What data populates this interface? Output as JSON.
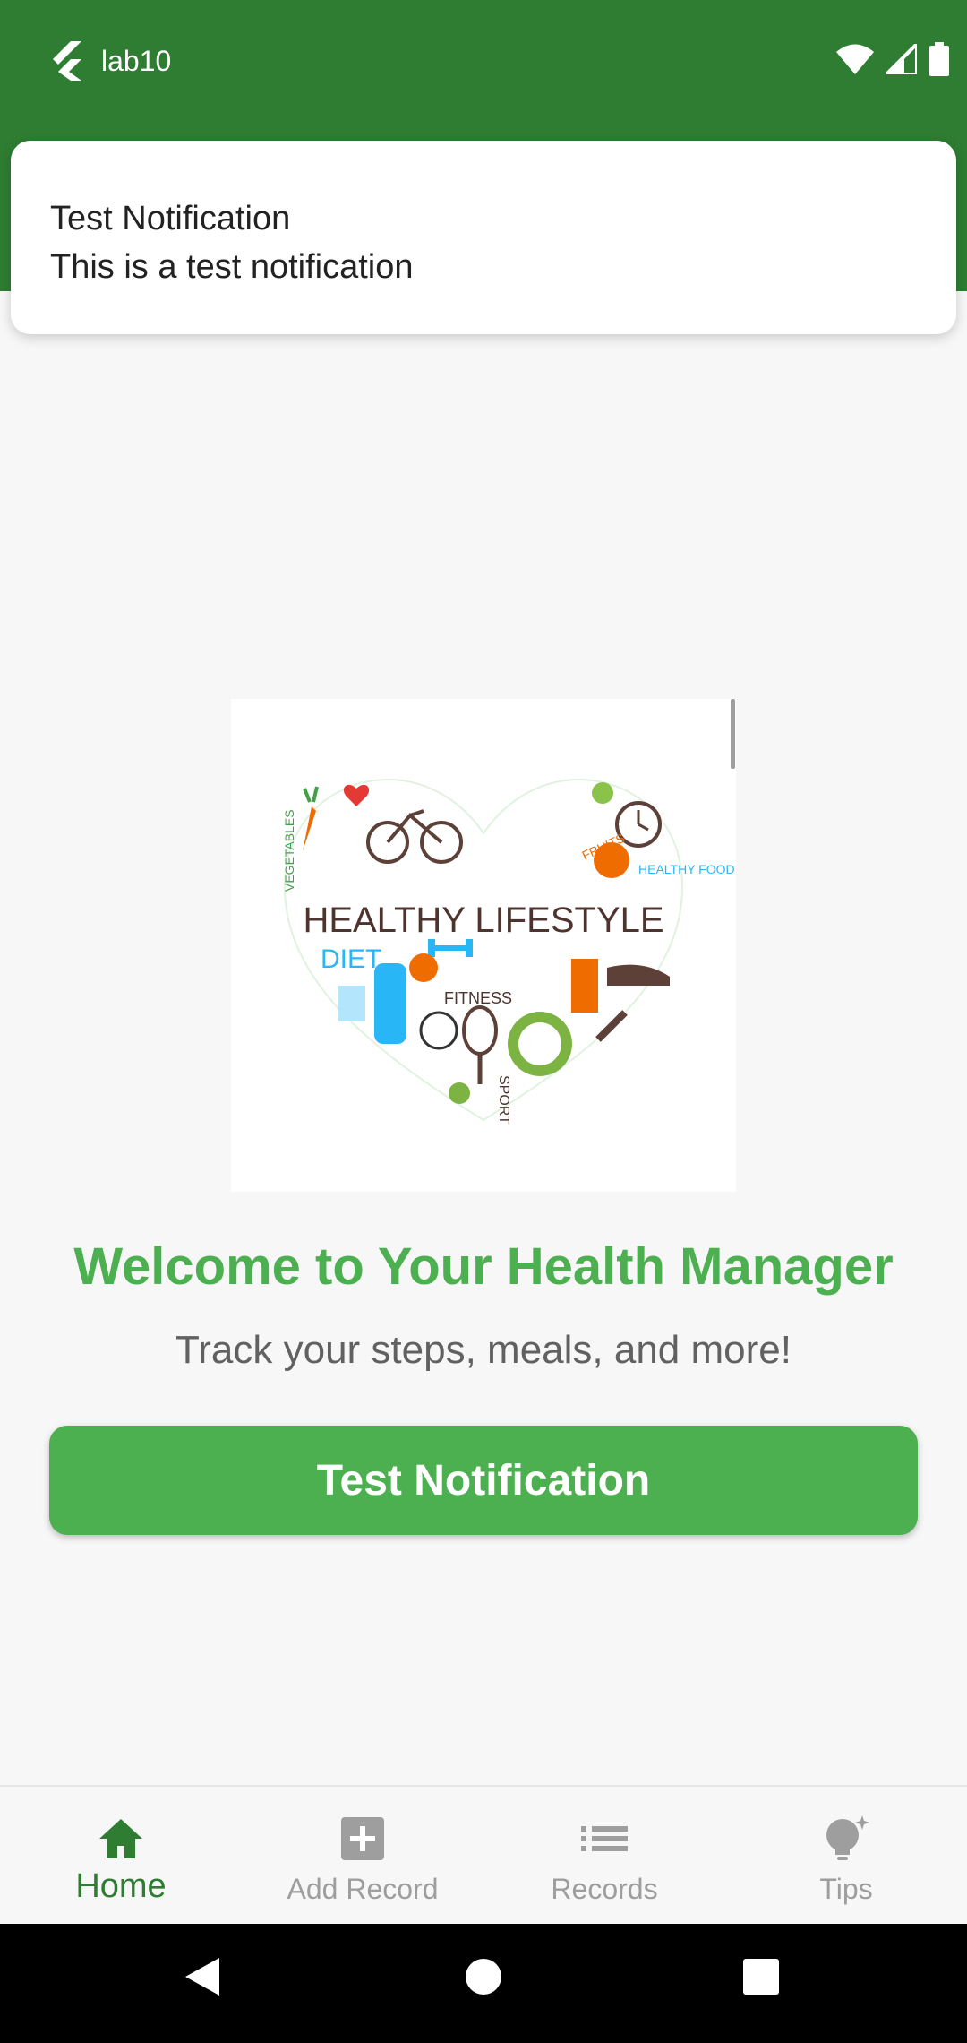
{
  "status_bar": {
    "app_name": "lab10",
    "icons": [
      "flutter-icon",
      "wifi-icon",
      "signal-icon",
      "battery-icon"
    ]
  },
  "notification": {
    "title": "Test Notification",
    "body": "This is a test notification"
  },
  "main": {
    "image_label": "HEALTHY LIFESTYLE",
    "image_words": [
      "DIET",
      "FITNESS",
      "SPORT",
      "FRUITS",
      "HEALTHY FOOD",
      "VEGETABLES"
    ],
    "title": "Welcome to Your Health Manager",
    "subtitle": "Track your steps, meals, and more!",
    "button_label": "Test Notification"
  },
  "bottom_nav": {
    "items": [
      {
        "label": "Home",
        "icon": "home-icon",
        "active": true
      },
      {
        "label": "Add Record",
        "icon": "add-box-icon",
        "active": false
      },
      {
        "label": "Records",
        "icon": "list-icon",
        "active": false
      },
      {
        "label": "Tips",
        "icon": "lightbulb-icon",
        "active": false
      }
    ]
  },
  "colors": {
    "primary_dark": "#2e7d32",
    "primary": "#4caf50",
    "background": "#f7f7f7"
  }
}
